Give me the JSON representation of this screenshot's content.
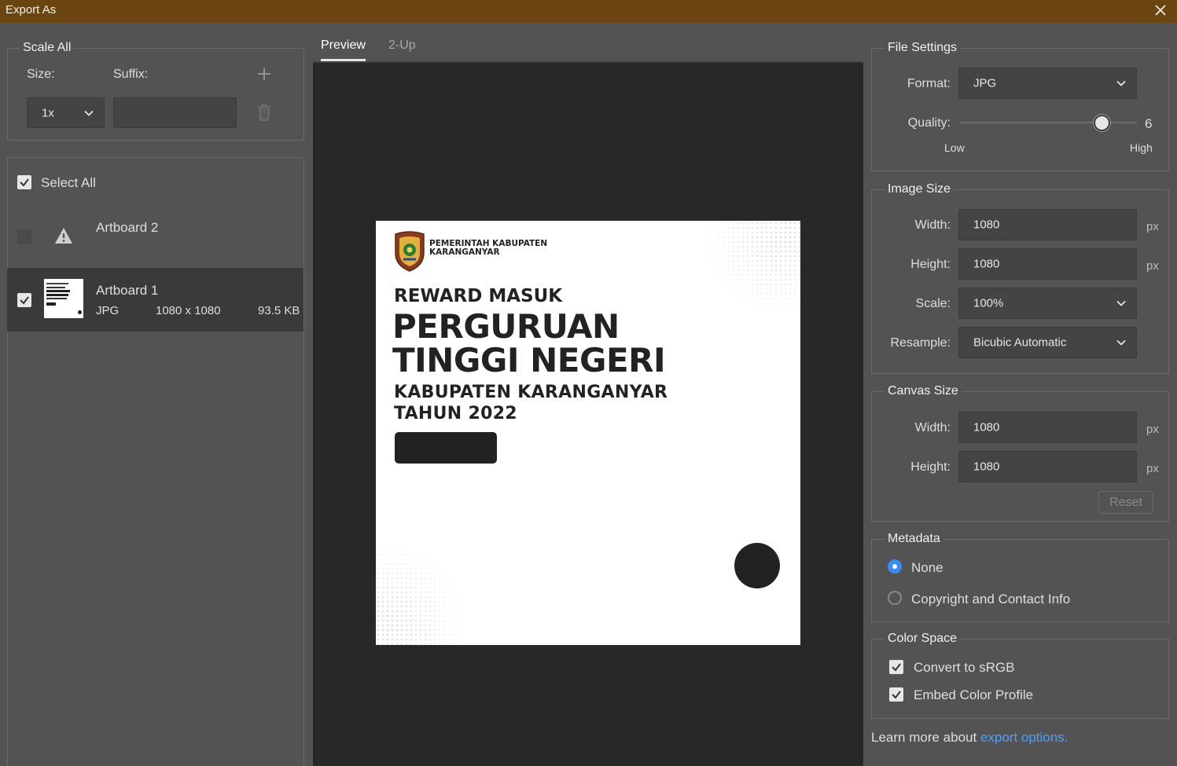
{
  "window": {
    "title": "Export As"
  },
  "scale_all": {
    "legend": "Scale All",
    "size_label": "Size:",
    "suffix_label": "Suffix:",
    "size_value": "1x",
    "suffix_value": ""
  },
  "select_all": {
    "label": "Select All",
    "checked": true
  },
  "artboards": [
    {
      "name": "Artboard 2",
      "checked": false,
      "warning": true
    },
    {
      "name": "Artboard 1",
      "checked": true,
      "format": "JPG",
      "dimensions": "1080 x 1080",
      "size": "93.5 KB"
    }
  ],
  "tabs": [
    {
      "label": "Preview",
      "active": true
    },
    {
      "label": "2-Up",
      "active": false
    }
  ],
  "preview_art": {
    "org": "PEMERINTAH KABUPATEN\nKARANGANYAR",
    "line1": "REWARD MASUK",
    "line2": "PERGURUAN",
    "line3": "TINGGI NEGERI",
    "line4": "KABUPATEN KARANGANYAR\nTAHUN 2022"
  },
  "file_settings": {
    "legend": "File Settings",
    "format_label": "Format:",
    "format_value": "JPG",
    "quality_label": "Quality:",
    "quality_value": "6",
    "quality_low": "Low",
    "quality_high": "High"
  },
  "image_size": {
    "legend": "Image Size",
    "width_label": "Width:",
    "width_value": "1080",
    "height_label": "Height:",
    "height_value": "1080",
    "unit": "px",
    "scale_label": "Scale:",
    "scale_value": "100%",
    "resample_label": "Resample:",
    "resample_value": "Bicubic Automatic"
  },
  "canvas_size": {
    "legend": "Canvas Size",
    "width_label": "Width:",
    "width_value": "1080",
    "height_label": "Height:",
    "height_value": "1080",
    "unit": "px",
    "reset_label": "Reset"
  },
  "metadata": {
    "legend": "Metadata",
    "options": [
      {
        "label": "None",
        "selected": true
      },
      {
        "label": "Copyright and Contact Info",
        "selected": false
      }
    ]
  },
  "color_space": {
    "legend": "Color Space",
    "convert_label": "Convert to sRGB",
    "convert_checked": true,
    "embed_label": "Embed Color Profile",
    "embed_checked": true
  },
  "footer": {
    "text": "Learn more about ",
    "link": "export options."
  },
  "colors": {
    "title_bar": "#6b4510",
    "panel": "#535353",
    "canvas_bg": "#282828",
    "accent_blue": "#378ef0",
    "link_blue": "#4ba0ff"
  }
}
